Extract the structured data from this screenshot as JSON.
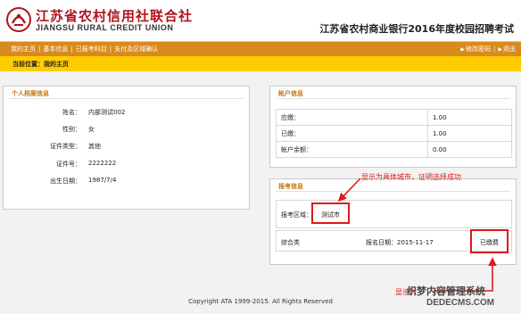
{
  "header": {
    "logo_cn": "江苏省农村信用社联合社",
    "logo_en": "JIANGSU RURAL CREDIT UNION",
    "site_title": "江苏省农村商业银行2016年度校园招聘考试"
  },
  "nav": {
    "items": [
      {
        "label": "我的主页"
      },
      {
        "label": "基本信息"
      },
      {
        "label": "已报考科目"
      },
      {
        "label": "支付及区域确认"
      }
    ],
    "separator": "|",
    "change_password": "修改密码",
    "logout": "退出"
  },
  "breadcrumb": "当前位置：我的主页",
  "profile": {
    "title": "个人档案信息",
    "fields": [
      {
        "label": "姓名：",
        "value": "内部测试002"
      },
      {
        "label": "性别：",
        "value": "女"
      },
      {
        "label": "证件类型：",
        "value": "其他"
      },
      {
        "label": "证件号：",
        "value": "2222222"
      },
      {
        "label": "出生日期：",
        "value": "1987/7/4"
      }
    ]
  },
  "account": {
    "title": "帐户信息",
    "rows": [
      {
        "label": "应缴：",
        "value": "1.00"
      },
      {
        "label": "已缴：",
        "value": "1.00"
      },
      {
        "label": "帐户余额：",
        "value": "0.00"
      }
    ]
  },
  "report": {
    "title": "报考信息",
    "area_label": "报考区域：",
    "area_value": "测试市",
    "category": "综合类",
    "date_label": "报名日期：",
    "date_value": "2015-11-17",
    "status": "已缴费"
  },
  "annotations": {
    "note_city": "显示为具体城市，证明选择成功",
    "note_paid": "显示为"
  },
  "footer": {
    "copyright": "Copyright ATA 1999-2015. All Rights Reserved"
  },
  "watermark": {
    "cn": "织梦内容管理系统",
    "en": "DEDECMS.COM"
  },
  "colors": {
    "nav_bg": "#d88a1c",
    "crumb_bg": "#ffcc00",
    "panel_title": "#c47a14",
    "annotation_red": "#e01818"
  }
}
